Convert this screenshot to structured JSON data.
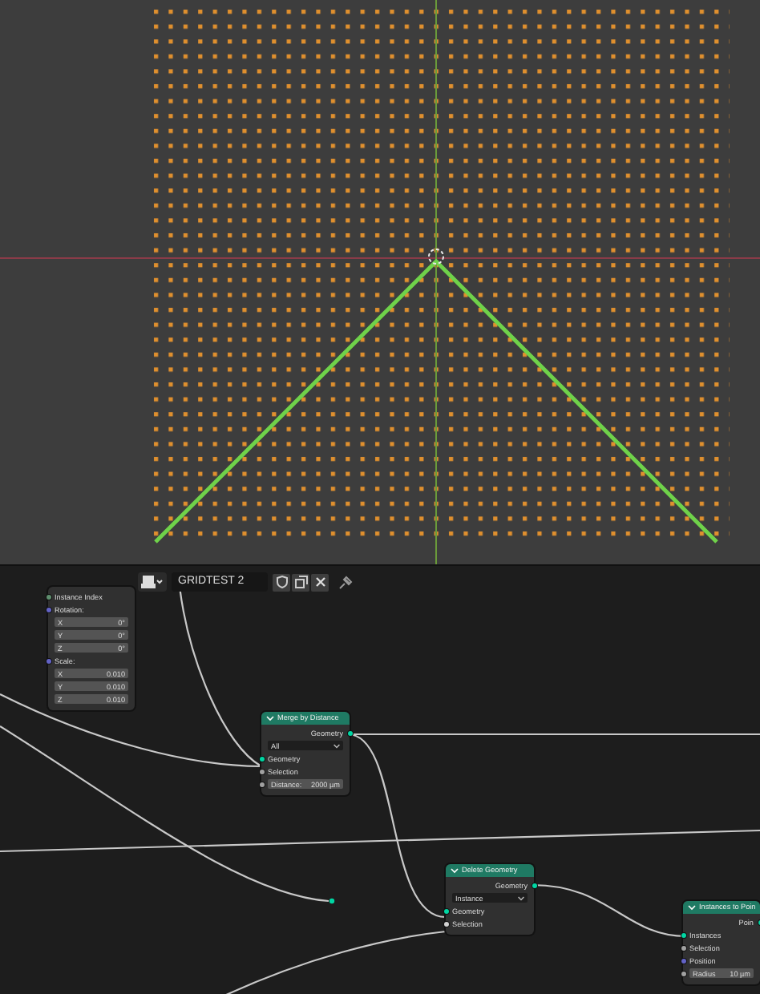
{
  "header": {
    "tree_name": "GRIDTEST 2"
  },
  "nodes": [
    {
      "rows": [
        {
          "kind": "input",
          "label": "Instance Index",
          "color": "#5f8f6f"
        },
        {
          "kind": "input",
          "label": "Rotation:",
          "color": "#6363c7"
        },
        {
          "kind": "field",
          "label": "X",
          "value": "0°"
        },
        {
          "kind": "field",
          "label": "Y",
          "value": "0°"
        },
        {
          "kind": "field",
          "label": "Z",
          "value": "0°"
        },
        {
          "kind": "input",
          "label": "Scale:",
          "color": "#6363c7"
        },
        {
          "kind": "field",
          "label": "X",
          "value": "0.010"
        },
        {
          "kind": "field",
          "label": "Y",
          "value": "0.010"
        },
        {
          "kind": "field",
          "label": "Z",
          "value": "0.010"
        }
      ]
    },
    {
      "title": "Merge by Distance",
      "rows": [
        {
          "kind": "output",
          "label": "Geometry",
          "color": "#00d6a3"
        },
        {
          "kind": "dropdown",
          "label": "All"
        },
        {
          "kind": "input",
          "label": "Geometry",
          "color": "#00d6a3"
        },
        {
          "kind": "input",
          "label": "Selection",
          "color": "#a1a1a1"
        },
        {
          "kind": "field",
          "label": "Distance:",
          "value": "2000 µm",
          "color": "#a1a1a1"
        }
      ]
    },
    {
      "title": "Delete Geometry",
      "rows": [
        {
          "kind": "output",
          "label": "Geometry",
          "color": "#00d6a3"
        },
        {
          "kind": "dropdown",
          "label": "Instance"
        },
        {
          "kind": "input",
          "label": "Geometry",
          "color": "#00d6a3"
        },
        {
          "kind": "input",
          "label": "Selection",
          "color": "#d0d0d0"
        }
      ]
    },
    {
      "title": "Instances to Poin",
      "rows": [
        {
          "kind": "output",
          "label": "Poin",
          "color": "#00d6a3"
        },
        {
          "kind": "input",
          "label": "Instances",
          "color": "#00d6a3"
        },
        {
          "kind": "input",
          "label": "Selection",
          "color": "#a1a1a1"
        },
        {
          "kind": "input",
          "label": "Position",
          "color": "#6363c7"
        },
        {
          "kind": "field",
          "label": "Radius",
          "value": "10 µm",
          "color": "#a1a1a1"
        }
      ]
    }
  ]
}
